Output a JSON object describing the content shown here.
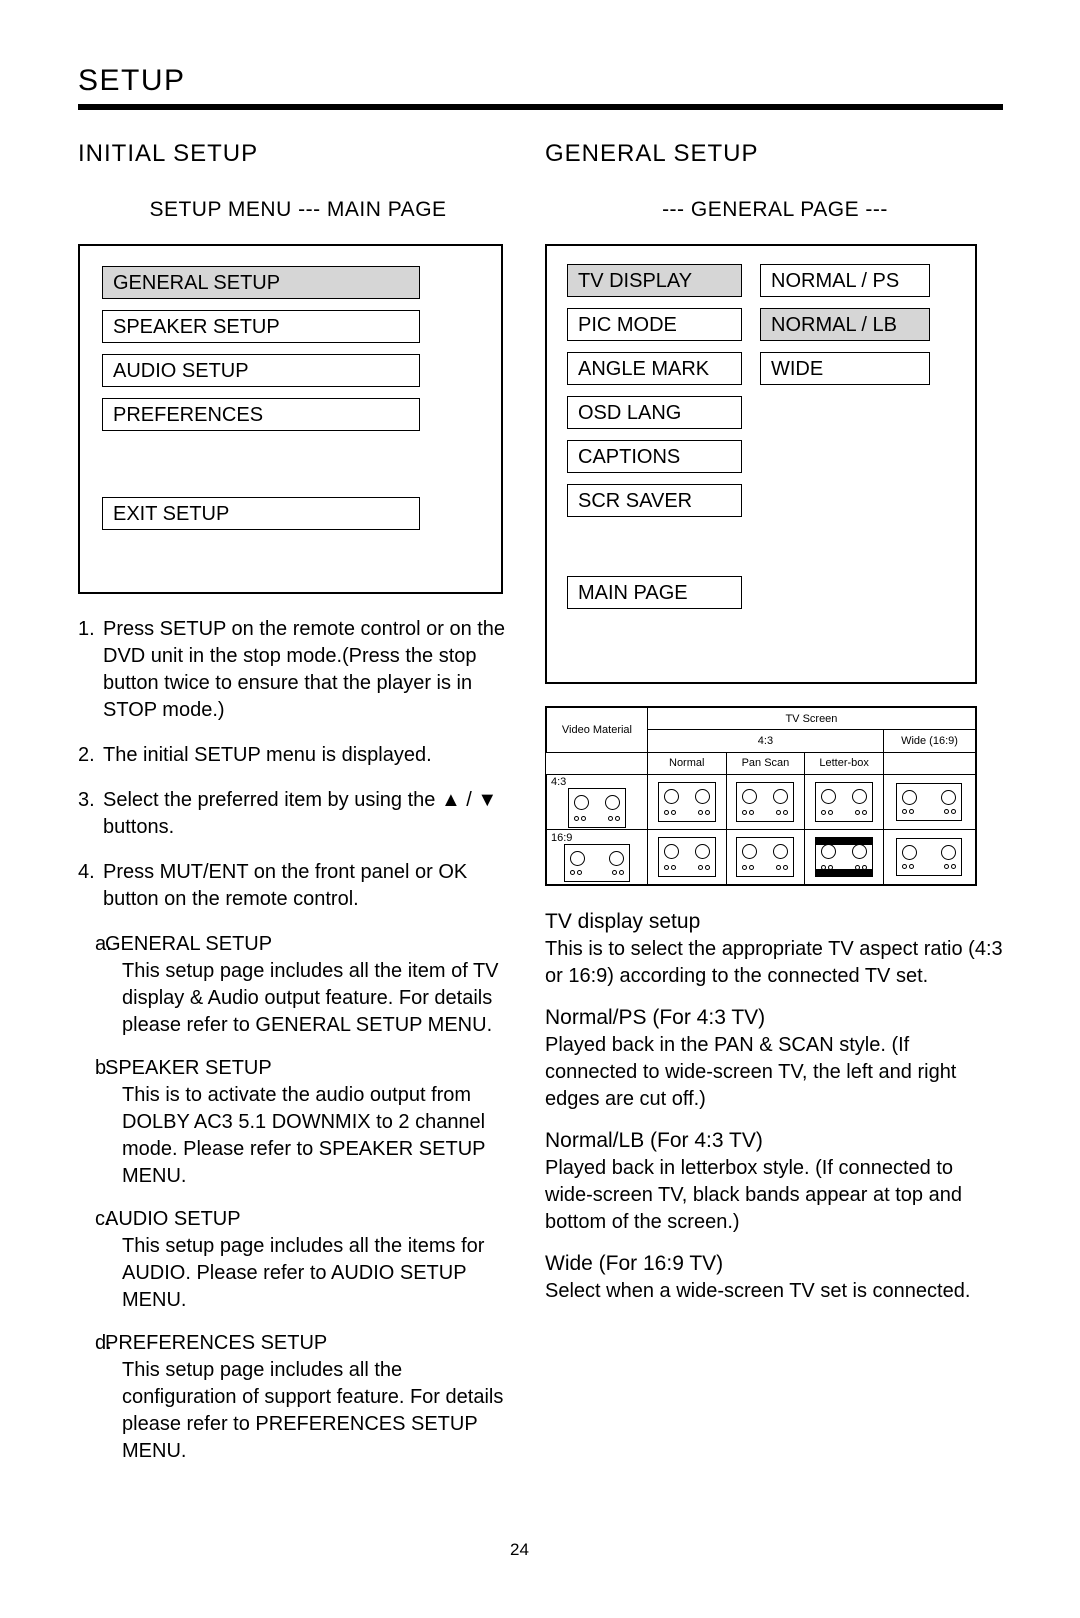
{
  "header": {
    "title": "SETUP"
  },
  "left": {
    "section_title": "INITIAL SETUP",
    "sub_title": "SETUP MENU --- MAIN PAGE",
    "menu_items": [
      {
        "label": "GENERAL SETUP",
        "selected": true
      },
      {
        "label": "SPEAKER SETUP",
        "selected": false
      },
      {
        "label": "AUDIO SETUP",
        "selected": false
      },
      {
        "label": "PREFERENCES",
        "selected": false
      }
    ],
    "exit_item": {
      "label": "EXIT SETUP",
      "selected": false
    },
    "steps": [
      {
        "num": "1.",
        "text": "Press SETUP on the remote control or on the DVD unit in the stop mode.(Press the stop button twice to ensure that the player is in STOP mode.)"
      },
      {
        "num": "2.",
        "text": "The initial SETUP menu is displayed."
      },
      {
        "num": "3.",
        "text": "Select the preferred item by using the ▲ / ▼ buttons."
      },
      {
        "num": "4.",
        "text": "Press MUT/ENT on the front panel or OK button on the remote control."
      }
    ],
    "sub_items": [
      {
        "letter": "a.",
        "head": "GENERAL SETUP",
        "body": "This setup page includes all the item of TV display & Audio output feature.  For details please refer to GENERAL SETUP MENU."
      },
      {
        "letter": "b.",
        "head": "SPEAKER SETUP",
        "body": "This is to activate the audio output from DOLBY AC3 5.1 DOWNMIX to 2 channel mode.  Please refer to SPEAKER SETUP MENU."
      },
      {
        "letter": "c.",
        "head": "AUDIO SETUP",
        "body": "This setup page includes all the items for AUDIO.  Please refer to AUDIO SETUP MENU."
      },
      {
        "letter": "d.",
        "head": "PREFERENCES SETUP",
        "body": "This setup page includes all the configuration of support feature. For details please refer to PREFERENCES SETUP MENU."
      }
    ]
  },
  "right": {
    "section_title": "GENERAL SETUP",
    "sub_title": "--- GENERAL PAGE ---",
    "left_items": [
      {
        "label": "TV DISPLAY",
        "selected": true
      },
      {
        "label": "PIC MODE",
        "selected": false
      },
      {
        "label": "ANGLE MARK",
        "selected": false
      },
      {
        "label": "OSD LANG",
        "selected": false
      },
      {
        "label": "CAPTIONS",
        "selected": false
      },
      {
        "label": "SCR SAVER",
        "selected": false
      }
    ],
    "right_items": [
      {
        "label": "NORMAL / PS",
        "selected": false
      },
      {
        "label": "NORMAL / LB",
        "selected": true
      },
      {
        "label": "WIDE",
        "selected": false
      }
    ],
    "main_page_item": {
      "label": "MAIN PAGE",
      "selected": false
    },
    "table": {
      "col_video": "Video Material",
      "head_screen": "TV Screen",
      "head_43": "4:3",
      "head_wide": "Wide (16:9)",
      "sub_normal": "Normal",
      "sub_panscan": "Pan Scan",
      "sub_letterbox": "Letter-box",
      "row1": "4:3",
      "row2": "16:9"
    },
    "paragraphs": [
      {
        "head": "TV display setup",
        "body": "This is to select the appropriate TV aspect ratio (4:3 or 16:9) according to the connected TV set."
      },
      {
        "head": "Normal/PS (For 4:3 TV)",
        "body": "Played back in the PAN & SCAN style. (If connected to wide-screen TV, the left and right edges are cut off.)"
      },
      {
        "head": "Normal/LB (For 4:3 TV)",
        "body": "Played back in letterbox style. (If connected to wide-screen TV, black bands appear at top and bottom of the screen.)"
      },
      {
        "head": "Wide (For 16:9 TV)",
        "body": "Select when a wide-screen TV set is connected."
      }
    ]
  },
  "page_number": "24"
}
